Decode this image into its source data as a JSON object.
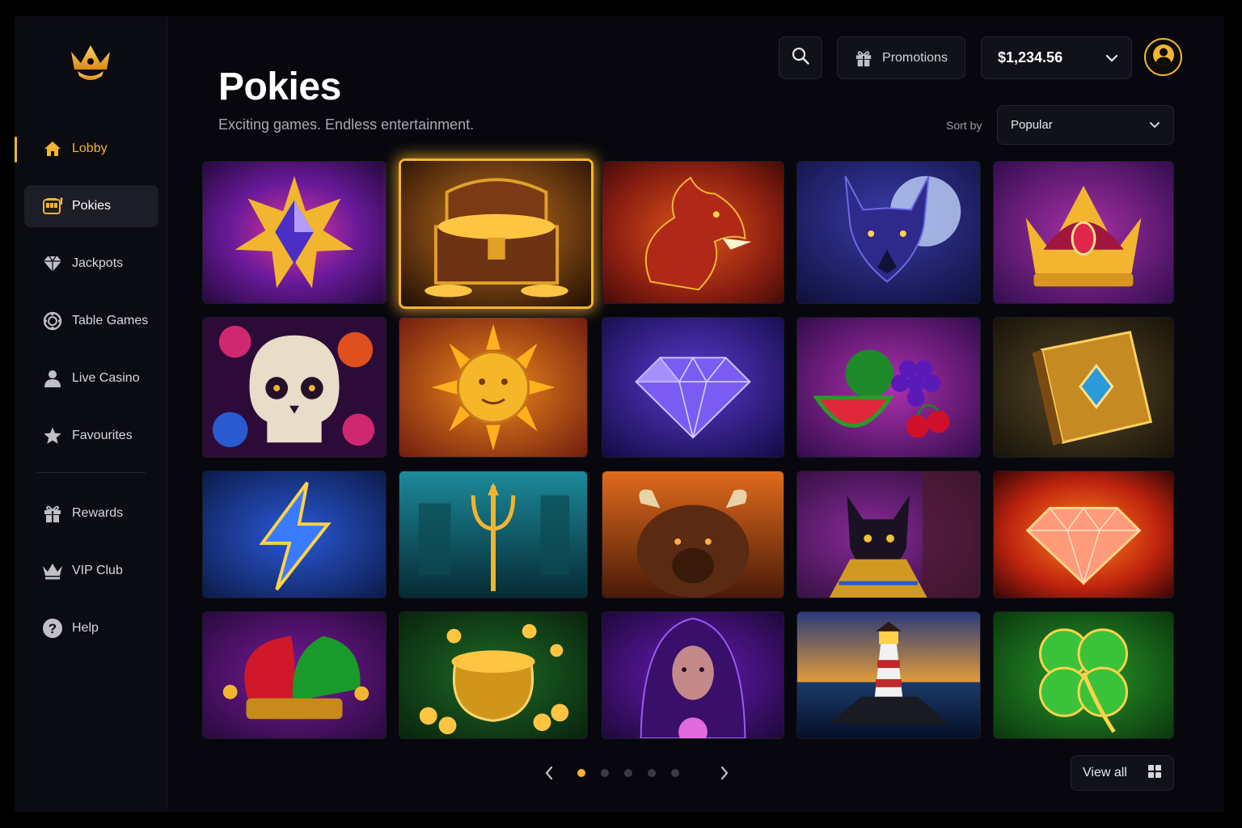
{
  "brand": {
    "logo_icon": "crown-icon",
    "accent": "#f2b530"
  },
  "sidebar": {
    "items": [
      {
        "label": "Lobby",
        "icon": "home-icon"
      },
      {
        "label": "Pokies",
        "icon": "slot-machine-icon"
      },
      {
        "label": "Jackpots",
        "icon": "diamond-icon"
      },
      {
        "label": "Table Games",
        "icon": "poker-chip-icon"
      },
      {
        "label": "Live Casino",
        "icon": "person-icon"
      },
      {
        "label": "Favourites",
        "icon": "star-icon"
      }
    ],
    "secondary": [
      {
        "label": "Rewards",
        "icon": "gift-icon"
      },
      {
        "label": "VIP Club",
        "icon": "crown-icon"
      },
      {
        "label": "Help",
        "icon": "help-icon"
      }
    ]
  },
  "header": {
    "title": "Pokies",
    "subtitle": "Exciting games. Endless entertainment.",
    "promotions_label": "Promotions",
    "balance": "$1,234.56"
  },
  "sort": {
    "label": "Sort by",
    "value": "Popular"
  },
  "games": [
    {
      "art": "magic-star"
    },
    {
      "art": "treasure-chest",
      "highlighted": true
    },
    {
      "art": "red-dragon"
    },
    {
      "art": "wolf-moon"
    },
    {
      "art": "royal-crown"
    },
    {
      "art": "sugar-skull"
    },
    {
      "art": "golden-sun"
    },
    {
      "art": "blue-diamond"
    },
    {
      "art": "fruits"
    },
    {
      "art": "golden-book"
    },
    {
      "art": "lightning-bolt"
    },
    {
      "art": "trident-atlantis"
    },
    {
      "art": "buffalo"
    },
    {
      "art": "egyptian-cat"
    },
    {
      "art": "fire-gem"
    },
    {
      "art": "jester-hat"
    },
    {
      "art": "pot-of-gold"
    },
    {
      "art": "hooded-sorceress"
    },
    {
      "art": "lighthouse"
    },
    {
      "art": "four-leaf-clover"
    }
  ],
  "pagination": {
    "pages": 5,
    "current": 1
  },
  "view_all_label": "View all"
}
